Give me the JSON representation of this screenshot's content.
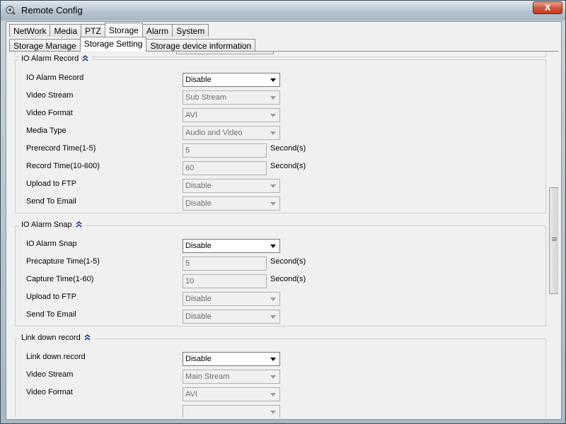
{
  "window": {
    "title": "Remote Config",
    "close_symbol": "X"
  },
  "tabs": [
    "NetWork",
    "Media",
    "PTZ",
    "Storage",
    "Alarm",
    "System"
  ],
  "active_tab": "Storage",
  "subtabs": [
    "Storage Manage",
    "Storage Setting",
    "Storage device information"
  ],
  "active_subtab": "Storage Setting",
  "io_alarm_record": {
    "title": "IO Alarm Record",
    "rows": {
      "record": {
        "label": "IO Alarm Record",
        "value": "Disable"
      },
      "video_stream": {
        "label": "Video Stream",
        "value": "Sub Stream"
      },
      "video_format": {
        "label": "Video Format",
        "value": "AVI"
      },
      "media_type": {
        "label": "Media Type",
        "value": "Audio and Video"
      },
      "prerecord": {
        "label": "Prerecord Time(1-5)",
        "value": "5",
        "unit": "Second(s)"
      },
      "record_time": {
        "label": "Record Time(10-600)",
        "value": "60",
        "unit": "Second(s)"
      },
      "upload_ftp": {
        "label": "Upload to FTP",
        "value": "Disable"
      },
      "send_email": {
        "label": "Send To Email",
        "value": "Disable"
      }
    }
  },
  "io_alarm_snap": {
    "title": "IO Alarm Snap",
    "rows": {
      "snap": {
        "label": "IO Alarm Snap",
        "value": "Disable"
      },
      "precapture": {
        "label": "Precapture Time(1-5)",
        "value": "5",
        "unit": "Second(s)"
      },
      "capture": {
        "label": "Capture Time(1-60)",
        "value": "10",
        "unit": "Second(s)"
      },
      "upload_ftp": {
        "label": "Upload to FTP",
        "value": "Disable"
      },
      "send_email": {
        "label": "Send To Email",
        "value": "Disable"
      }
    }
  },
  "link_down_record": {
    "title": "Link down record",
    "rows": {
      "record": {
        "label": "Link down record",
        "value": "Disable"
      },
      "video_stream": {
        "label": "Video Stream",
        "value": "Main Stream"
      },
      "video_format": {
        "label": "Video Format",
        "value": "AVI"
      }
    }
  }
}
